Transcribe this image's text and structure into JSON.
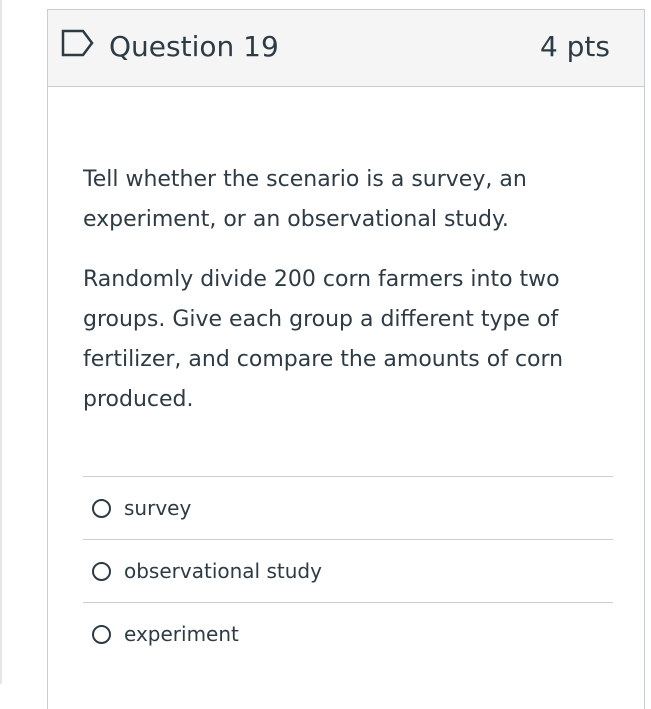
{
  "question": {
    "title": "Question 19",
    "points": "4 pts",
    "flag_icon": "flag-outline-icon",
    "prompt": "Tell whether the scenario is a survey, an experiment, or an observational study.",
    "scenario": "Randomly divide 200 corn farmers into two groups.  Give each group a different type of fertilizer, and compare the amounts of corn produced."
  },
  "answers": [
    {
      "label": "survey",
      "selected": false
    },
    {
      "label": "observational study",
      "selected": false
    },
    {
      "label": "experiment",
      "selected": false
    }
  ],
  "colors": {
    "text": "#2d3b45",
    "header_bg": "#f5f5f5",
    "border": "#c7cdd1"
  }
}
